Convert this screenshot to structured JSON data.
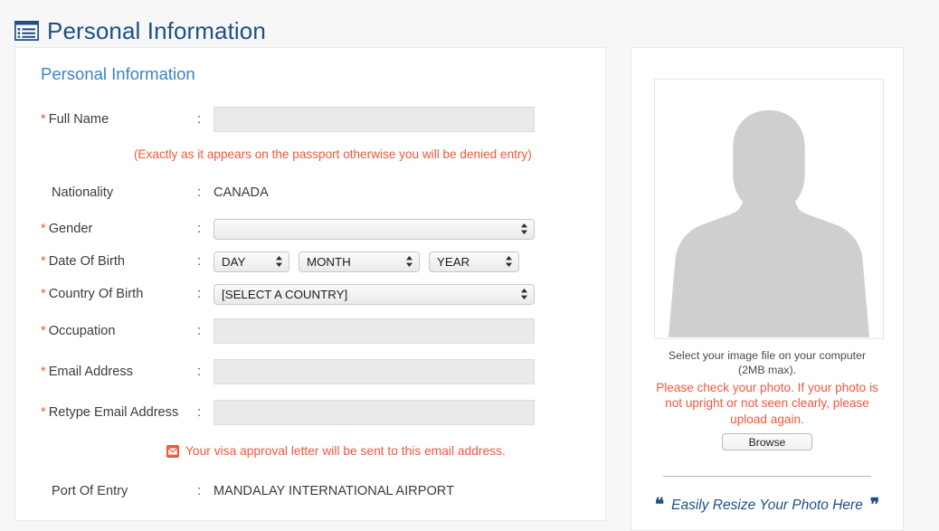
{
  "header": {
    "title": "Personal Information",
    "icon": "list-icon",
    "title_color": "#1d4f86"
  },
  "form": {
    "section_title": "Personal Information",
    "section_title_color": "#3d82c4",
    "colon": ":",
    "required_marker": "*",
    "required_color": "#f4563c",
    "rows": {
      "full_name": {
        "label": "Full Name",
        "value": "",
        "placeholder": ""
      },
      "full_name_note": "(Exactly as it appears on the passport otherwise you will be denied entry)",
      "nationality": {
        "label": "Nationality",
        "value": "CANADA"
      },
      "gender": {
        "label": "Gender",
        "selected": ""
      },
      "date_of_birth": {
        "label": "Date Of Birth",
        "day": "DAY",
        "month": "MONTH",
        "year": "YEAR"
      },
      "country_of_birth": {
        "label": "Country Of Birth",
        "selected": "[SELECT A COUNTRY]"
      },
      "occupation": {
        "label": "Occupation",
        "value": "",
        "placeholder": ""
      },
      "email": {
        "label": "Email Address",
        "value": "",
        "placeholder": ""
      },
      "retype_email": {
        "label": "Retype Email Address",
        "value": "",
        "placeholder": ""
      },
      "email_note": "Your visa approval letter will be sent to this email address.",
      "email_note_icon": "envelope-icon",
      "port_of_entry": {
        "label": "Port Of Entry",
        "value": "MANDALAY INTERNATIONAL AIRPORT"
      }
    }
  },
  "photo": {
    "placeholder_icon": "person-silhouette-icon",
    "caption": "Select your image file on your computer (2MB max).",
    "warning": "Please check your photo. If your photo is not upright or not seen clearly, please upload again.",
    "warning_color": "#f4563c",
    "browse_label": "Browse",
    "resize_link": "Easily Resize Your Photo Here",
    "quote_open": "“",
    "quote_close": "”"
  }
}
